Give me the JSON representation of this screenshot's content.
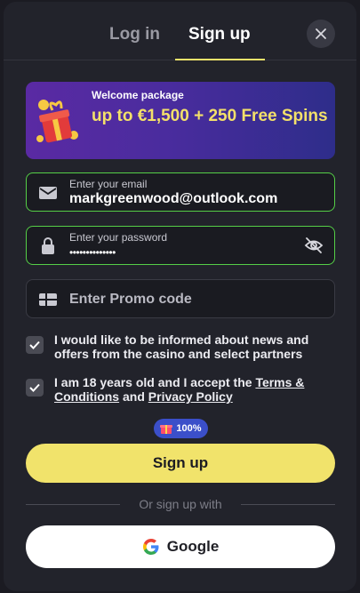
{
  "tabs": {
    "login": "Log in",
    "signup": "Sign up"
  },
  "close_icon": "close-icon",
  "banner": {
    "small": "Welcome package",
    "big": "up to €1,500 + 250 Free Spins",
    "icon": "gift-icon"
  },
  "email": {
    "label": "Enter your email",
    "value": "markgreenwood@outlook.com",
    "icon": "mail-icon"
  },
  "password": {
    "label": "Enter your password",
    "value": "••••••••••••••",
    "icon": "lock-icon",
    "toggle_icon": "eye-off-icon"
  },
  "promo": {
    "placeholder": "Enter Promo code",
    "icon": "gift-card-icon"
  },
  "consent": {
    "news": "I would like to be informed about news and offers from the casino and select partners",
    "age_prefix": "I am 18 years old and I accept the",
    "terms": "Terms & Conditions",
    "and": "and",
    "privacy": "Privacy Policy"
  },
  "badge": {
    "value": "100%",
    "icon": "gift-icon"
  },
  "signup_button": "Sign up",
  "or_text": "Or sign up with",
  "google_button": "Google",
  "colors": {
    "accent": "#f1e36b",
    "active_border": "#55cf47",
    "background": "#22232b",
    "badge": "#3b4fc9"
  }
}
